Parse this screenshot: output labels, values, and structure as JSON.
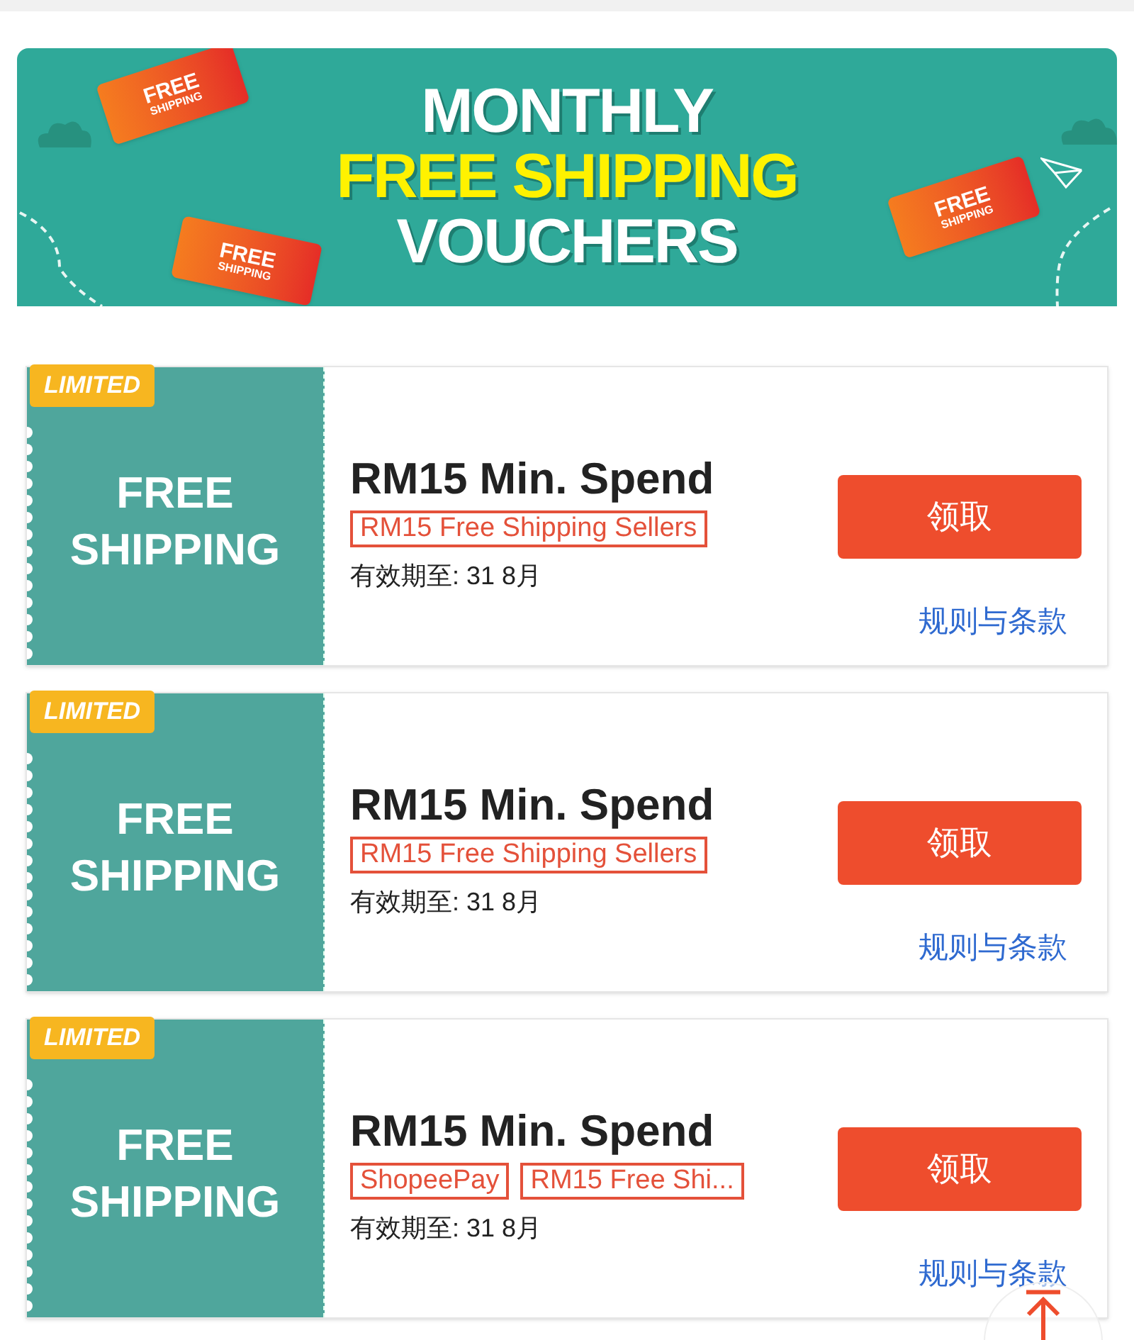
{
  "banner": {
    "title_lines": [
      "MONTHLY",
      "FREE SHIPPING",
      "VOUCHERS"
    ],
    "stickers": [
      {
        "line_1": "FREE",
        "line_2": "SHIPPING"
      },
      {
        "line_1": "FREE",
        "line_2": "SHIPPING"
      },
      {
        "line_1": "FREE",
        "line_2": "SHIPPING"
      }
    ]
  },
  "vouchers": [
    {
      "badge": "LIMITED",
      "left_label": [
        "FREE",
        "SHIPPING"
      ],
      "title": "RM15 Min. Spend",
      "tags": [
        "RM15 Free Shipping Sellers"
      ],
      "validity": "有效期至: 31 8月",
      "claim_button": "领取",
      "terms_link": "规则与条款"
    },
    {
      "badge": "LIMITED",
      "left_label": [
        "FREE",
        "SHIPPING"
      ],
      "title": "RM15 Min. Spend",
      "tags": [
        "RM15 Free Shipping Sellers"
      ],
      "validity": "有效期至: 31 8月",
      "claim_button": "领取",
      "terms_link": "规则与条款"
    },
    {
      "badge": "LIMITED",
      "left_label": [
        "FREE",
        "SHIPPING"
      ],
      "title": "RM15 Min. Spend",
      "tags": [
        "ShopeePay",
        "RM15 Free Shi..."
      ],
      "validity": "有效期至: 31 8月",
      "claim_button": "领取",
      "terms_link": "规则与条款"
    }
  ]
}
